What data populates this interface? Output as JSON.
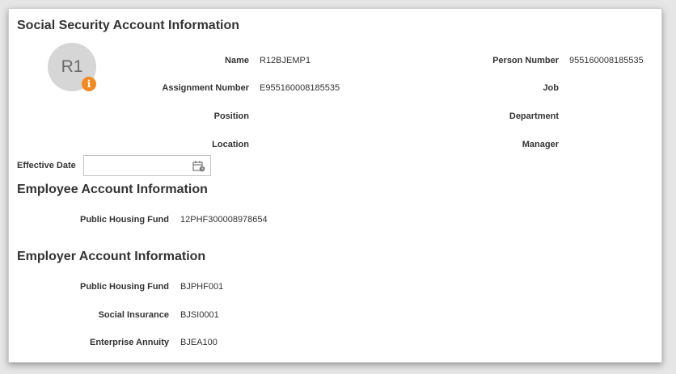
{
  "page": {
    "title": "Social Security Account Information"
  },
  "person": {
    "avatar_initials": "R1",
    "info_badge": "i",
    "fields_left": [
      {
        "label": "Name",
        "value": "R12BJEMP1"
      },
      {
        "label": "Assignment Number",
        "value": "E955160008185535"
      },
      {
        "label": "Position",
        "value": ""
      },
      {
        "label": "Location",
        "value": ""
      }
    ],
    "fields_right": [
      {
        "label": "Person Number",
        "value": "955160008185535"
      },
      {
        "label": "Job",
        "value": ""
      },
      {
        "label": "Department",
        "value": ""
      },
      {
        "label": "Manager",
        "value": ""
      }
    ]
  },
  "effective_date": {
    "label": "Effective Date",
    "value": "",
    "placeholder": ""
  },
  "employee_account": {
    "title": "Employee Account Information",
    "fields": [
      {
        "label": "Public Housing Fund",
        "value": "12PHF300008978654"
      }
    ]
  },
  "employer_account": {
    "title": "Employer Account Information",
    "fields": [
      {
        "label": "Public Housing Fund",
        "value": "BJPHF001"
      },
      {
        "label": "Social Insurance",
        "value": "BJSI0001"
      },
      {
        "label": "Enterprise Annuity",
        "value": "BJEA100"
      }
    ]
  },
  "colors": {
    "badge": "#f08a24",
    "avatar_bg": "#d6d6d6",
    "text": "#333333"
  },
  "icons": {
    "calendar": "calendar-icon",
    "info": "info-icon"
  }
}
